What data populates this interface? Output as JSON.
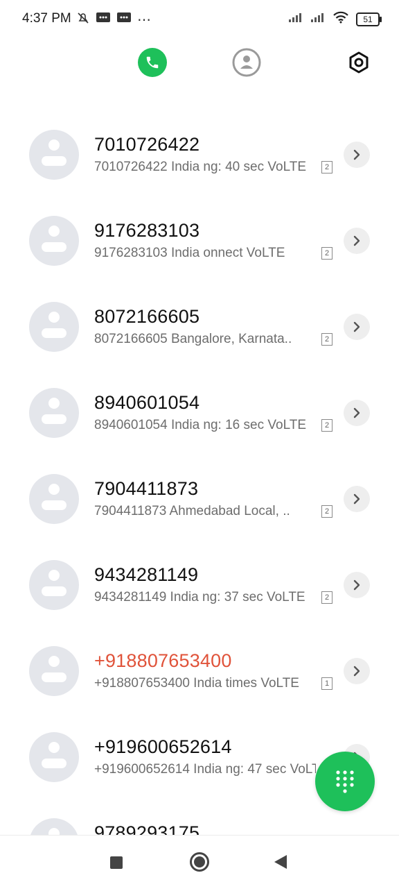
{
  "status_bar": {
    "time": "4:37 PM",
    "battery": "51",
    "icons": [
      "mute-bell-icon",
      "message-icon",
      "message-icon",
      "more-dots-icon",
      "signal-icon",
      "signal-icon",
      "wifi-icon",
      "battery-icon"
    ]
  },
  "top_nav": {
    "tabs": [
      "calls-icon",
      "contacts-icon",
      "settings-icon"
    ],
    "active_color": "#1ec05a"
  },
  "calls": [
    {
      "number": "7010726422",
      "details": "7010726422 India  ng: 40 sec VoLTE",
      "sim": "2",
      "missed": false
    },
    {
      "number": "9176283103",
      "details": "9176283103 India  onnect VoLTE",
      "sim": "2",
      "missed": false
    },
    {
      "number": "8072166605",
      "details": "8072166605 Bangalore, Karnata..",
      "sim": "2",
      "missed": false
    },
    {
      "number": "8940601054",
      "details": "8940601054 India  ng: 16 sec VoLTE",
      "sim": "2",
      "missed": false
    },
    {
      "number": "7904411873",
      "details": "7904411873 Ahmedabad Local, ..",
      "sim": "2",
      "missed": false
    },
    {
      "number": "9434281149",
      "details": "9434281149 India  ng: 37 sec VoLTE",
      "sim": "2",
      "missed": false
    },
    {
      "number": "+918807653400",
      "details": "+918807653400 India  times VoLTE",
      "sim": "1",
      "missed": true
    },
    {
      "number": "+919600652614",
      "details": "+919600652614 India  ng: 47 sec VoLTE",
      "sim": "2",
      "missed": false
    },
    {
      "number": "9789293175",
      "details": "",
      "sim": "",
      "missed": false
    }
  ],
  "colors": {
    "missed": "#e0533a",
    "accent": "#1ec05a"
  },
  "fab": {
    "icon": "dialpad-icon"
  },
  "bottom_nav": {
    "icons": [
      "recents-square-icon",
      "home-circle-icon",
      "back-triangle-icon"
    ]
  }
}
